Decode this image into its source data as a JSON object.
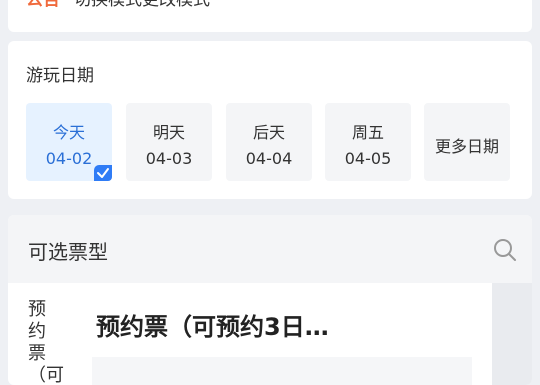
{
  "notice": {
    "tag": "公告",
    "text": "切换模式更改模式"
  },
  "visit_date": {
    "title": "游玩日期",
    "options": [
      {
        "day": "今天",
        "date": "04-02",
        "selected": true
      },
      {
        "day": "明天",
        "date": "04-03",
        "selected": false
      },
      {
        "day": "后天",
        "date": "04-04",
        "selected": false
      },
      {
        "day": "周五",
        "date": "04-05",
        "selected": false
      }
    ],
    "more_label": "更多日期"
  },
  "tickets": {
    "section_title": "可选票型",
    "category_label": "预约票（可",
    "items": [
      {
        "name": "预约票（可预约3日…"
      }
    ]
  },
  "colors": {
    "accent": "#2f7cf6",
    "notice_tag": "#f06a3c",
    "selected_bg": "#e6f2ff"
  }
}
